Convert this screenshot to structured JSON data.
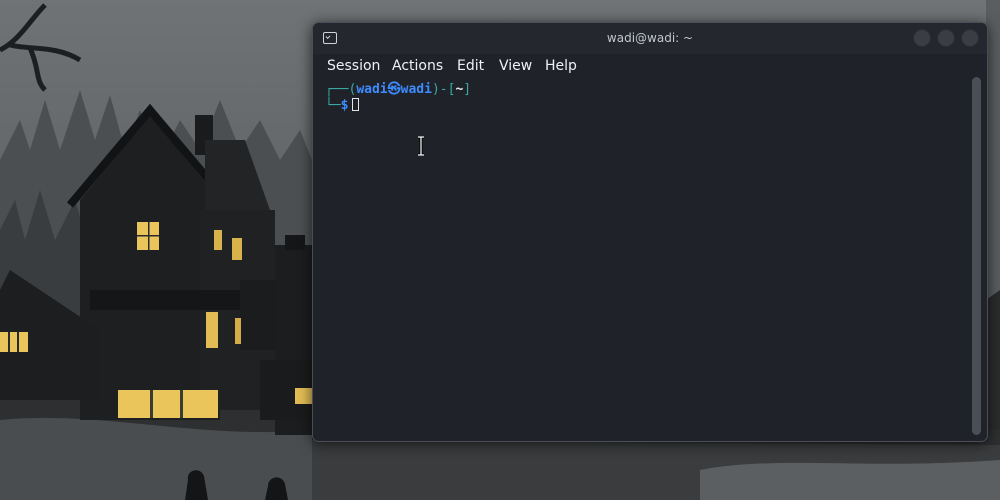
{
  "window": {
    "title": "wadi@wadi: ~",
    "icon": "terminal-icon"
  },
  "menu": {
    "items": [
      "Session",
      "Actions",
      "Edit",
      "View",
      "Help"
    ]
  },
  "terminal": {
    "prompt_open": "┌──(",
    "user": "wadi",
    "separator": "㉿",
    "host": "wadi",
    "path_open": ")-[",
    "path": "~",
    "path_close": "]",
    "prompt_second_prefix": "└─",
    "prompt_symbol": "$"
  },
  "colors": {
    "terminal_bg": "#1f2229",
    "prompt_frame": "#3aa8a0",
    "prompt_user": "#3e8bff"
  }
}
